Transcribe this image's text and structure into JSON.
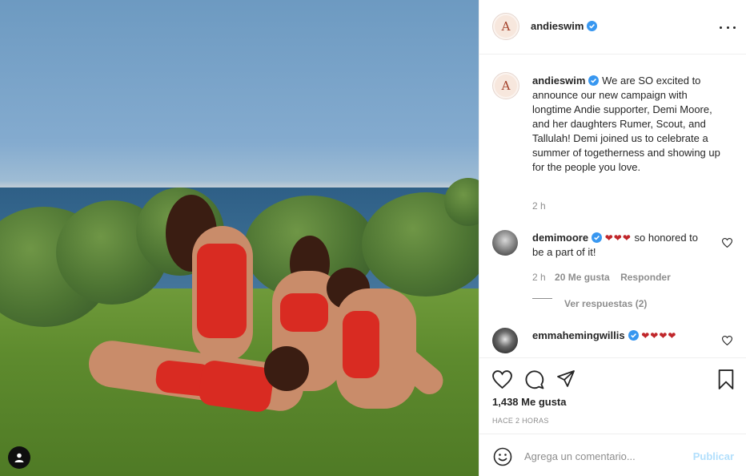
{
  "post": {
    "account": "andieswim",
    "avatar_letter": "A",
    "caption": "We are SO excited to announce our new campaign with longtime Andie supporter, Demi Moore, and her daughters Rumer, Scout, and Tallulah! Demi joined us to celebrate a summer of togetherness and showing up for the people you love.",
    "caption_age": "2 h",
    "likes": "1,438 Me gusta",
    "posted": "HACE 2 HORAS"
  },
  "comments": [
    {
      "user": "demimoore",
      "hearts": "❤❤❤",
      "text": "so honored to be a part of it!",
      "age": "2 h",
      "likes": "20 Me gusta",
      "reply": "Responder",
      "view_replies": "Ver respuestas (2)"
    },
    {
      "user": "emmahemingwillis",
      "hearts": "❤❤❤❤"
    }
  ],
  "composer": {
    "placeholder": "Agrega un comentario...",
    "post_label": "Publicar"
  },
  "icons": [
    "more-icon",
    "verified-icon",
    "heart-icon",
    "comment-icon",
    "share-icon",
    "bookmark-icon",
    "emoji-icon",
    "user-tag-icon"
  ],
  "colors": {
    "verified": "#3897f0",
    "post_button_disabled": "#b2dffc",
    "heart": "#c0262a"
  }
}
